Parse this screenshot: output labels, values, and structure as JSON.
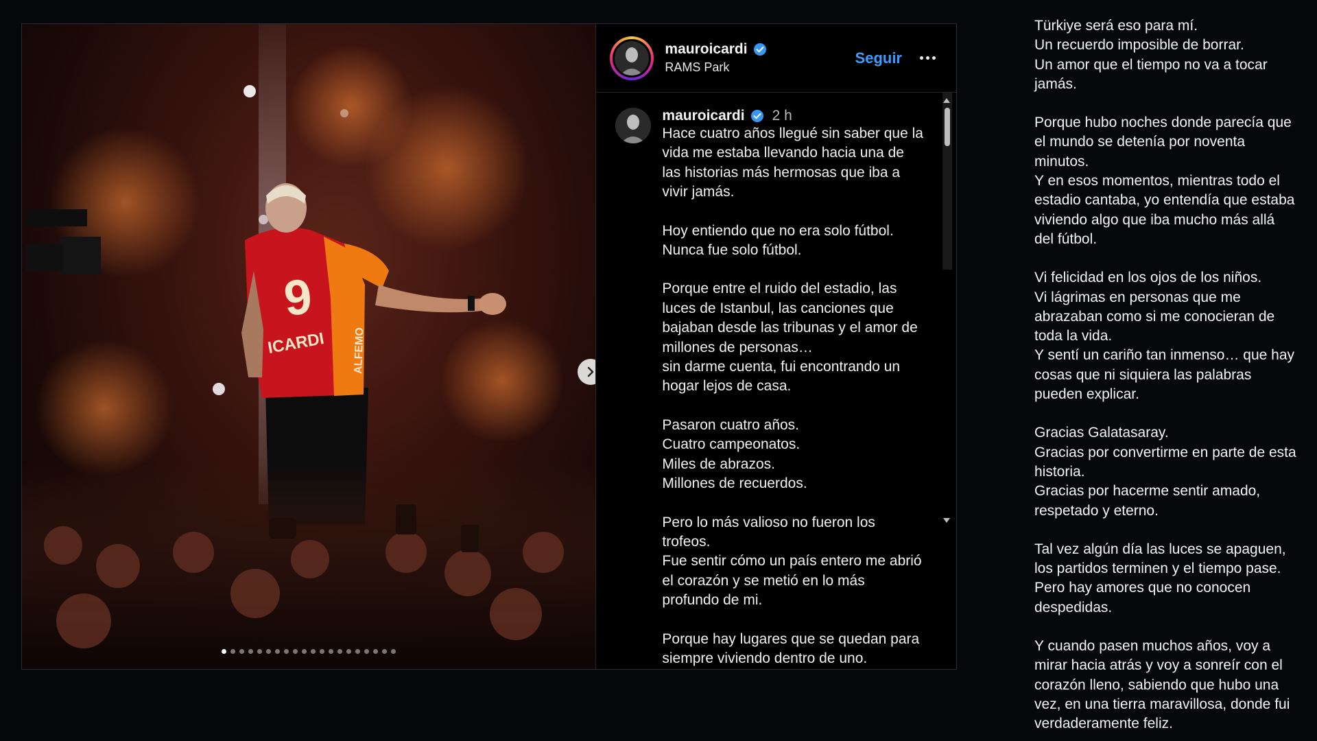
{
  "post": {
    "header": {
      "username": "mauroicardi",
      "location": "RAMS Park",
      "follow_label": "Seguir"
    },
    "media": {
      "jersey_number": "9",
      "jersey_name": "ICARDI",
      "sleeve_text": "ALFEMO",
      "carousel_total": 20,
      "carousel_active": 1
    },
    "caption": {
      "username": "mauroicardi",
      "time": "2 h",
      "paragraphs": [
        "Hace cuatro años llegué sin saber que la\nvida me estaba llevando hacia una de\nlas historias más hermosas que iba a\nvivir jamás.",
        "Hoy entiendo que no era solo fútbol.\nNunca fue solo fútbol.",
        "Porque entre el ruido del estadio, las\nluces de Istanbul, las canciones que\nbajaban desde las tribunas y el amor de\nmillones de personas…\nsin darme cuenta, fui encontrando un\nhogar lejos de casa.",
        "Pasaron cuatro años.\nCuatro campeonatos.\nMiles de abrazos.\nMillones de recuerdos.",
        "Pero lo más valioso no fueron los\ntrofeos.\nFue sentir cómo un país entero me abrió\nel corazón y se metió en lo más\nprofundo de mi.",
        "Porque hay lugares que se quedan para\nsiempre viviendo dentro de uno."
      ]
    }
  },
  "poem": {
    "paragraphs": [
      "Türkiye será eso para mí.\nUn recuerdo imposible de borrar.\nUn amor que el tiempo no va a tocar\njamás.",
      "Porque hubo noches donde parecía que\nel mundo se detenía por noventa\nminutos.\nY en esos momentos, mientras todo el\nestadio cantaba, yo entendía que estaba\nviviendo algo que iba mucho más allá\ndel fútbol.",
      "Vi felicidad en los ojos de los niños.\nVi lágrimas en personas que me\nabrazaban como si me conocieran de\ntoda la vida.\nY sentí un cariño tan inmenso… que hay\ncosas que ni siquiera las palabras\npueden explicar.",
      "Gracias Galatasaray.\nGracias por convertirme en parte de esta\nhistoria.\nGracias por hacerme sentir amado,\nrespetado y eterno.",
      "Tal vez algún día las luces se apaguen,\nlos partidos terminen y el tiempo pase.\nPero hay amores que no conocen\ndespedidas.",
      "Y cuando pasen muchos años, voy a\nmirar hacia atrás y voy a sonreír con el\ncorazón lleno, sabiendo que hubo una\nvez, en una tierra maravillosa, donde fui\nverdaderamente feliz."
    ]
  },
  "colors": {
    "follow_blue": "#3f9cff",
    "verified_blue": "#3897f0",
    "background": "#05070b",
    "jersey_red": "#c8151d",
    "jersey_orange": "#f07a12"
  }
}
